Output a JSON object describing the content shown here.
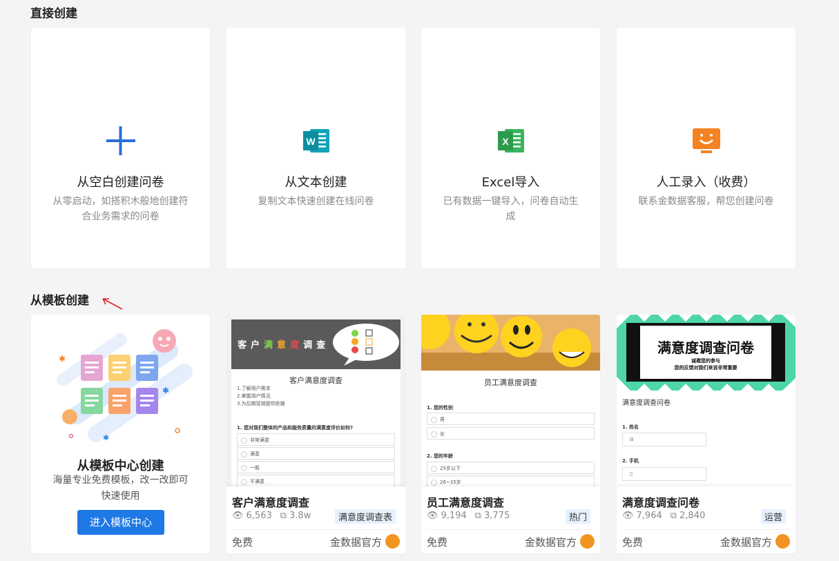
{
  "sections": {
    "direct": "直接创建",
    "template": "从模板创建"
  },
  "create_cards": [
    {
      "title": "从空白创建问卷",
      "desc": "从零启动，如搭积木般地创建符合业务需求的问卷",
      "icon": "plus-icon"
    },
    {
      "title": "从文本创建",
      "desc": "复制文本快速创建在线问卷",
      "icon": "word-icon"
    },
    {
      "title": "Excel导入",
      "desc": "已有数据一键导入，问卷自动生成",
      "icon": "excel-icon"
    },
    {
      "title": "人工录入（收费）",
      "desc": "联系金数据客服，帮您创建问卷",
      "icon": "monitor-smile-icon"
    }
  ],
  "template_center": {
    "title": "从模板中心创建",
    "desc": "海量专业免费模板，改一改即可快速使用",
    "button": "进入模板中心"
  },
  "templates": [
    {
      "name": "客户满意度调查",
      "views": "6,563",
      "uses": "3.8w",
      "tag": "满意度调查表",
      "price": "免费",
      "author": "金数据官方",
      "preview": {
        "banner_chars": [
          "客",
          "户",
          "满",
          "意",
          "度",
          "调",
          "查"
        ],
        "title": "客户满意度调查",
        "notes": [
          "1.了解用户需求",
          "2.掌握用户情况",
          "3.为后期营销提供依据"
        ],
        "question": "1. 您对我们整体的产品和服务质量的满意度评价如何?",
        "options": [
          "非常满意",
          "满意",
          "一般",
          "不满意"
        ]
      }
    },
    {
      "name": "员工满意度调查",
      "views": "9,194",
      "uses": "3,775",
      "tag": "热门",
      "price": "免费",
      "author": "金数据官方",
      "preview": {
        "title": "员工满意度调查",
        "q1": "1. 您的性别",
        "q1_options": [
          "男",
          "女"
        ],
        "q2": "2. 您的年龄",
        "q2_options": [
          "25岁以下",
          "26~35岁"
        ]
      }
    },
    {
      "name": "满意度调查问卷",
      "views": "7,964",
      "uses": "2,840",
      "tag": "运营",
      "price": "免费",
      "author": "金数据官方",
      "preview": {
        "banner_title": "满意度调查问卷",
        "banner_sub1": "诚邀您的参与",
        "banner_sub2": "您的反馈对我们来说非常重要",
        "title": "满意度调查问卷",
        "q1": "1. 姓名",
        "q2": "2. 手机"
      }
    }
  ],
  "colors": {
    "primary": "#1e78e6",
    "word": "#14a3b8",
    "excel": "#2ea44f",
    "orange": "#f58220"
  }
}
